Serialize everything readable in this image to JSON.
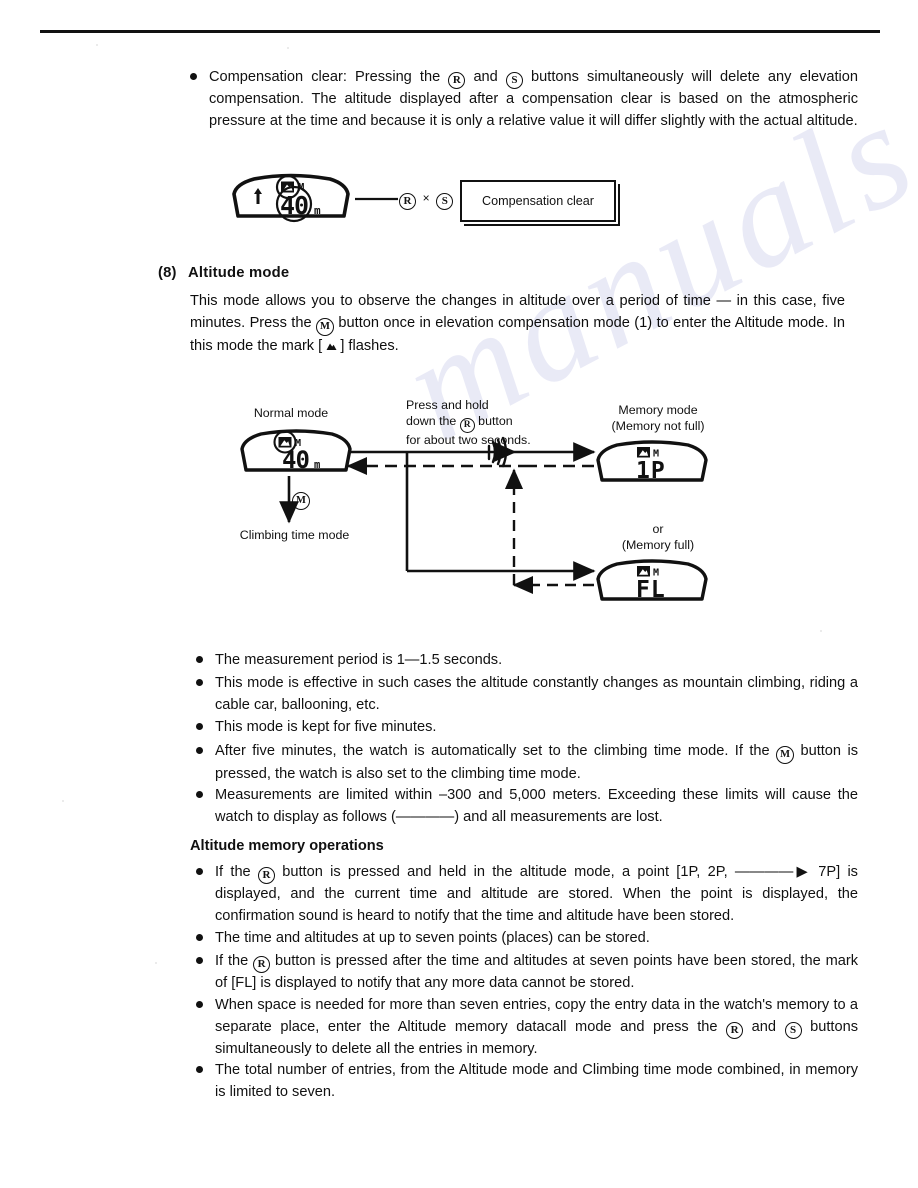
{
  "page": {
    "rule_present": true
  },
  "compensation_clear": {
    "bullet": "Compensation clear: Pressing the ⓡ and ⓢ buttons simultaneously will delete any elevation compensation. The altitude displayed after a compensation clear is based on the atmospheric pressure at the time and because it is only a relative value it will differ slightly with the actual altitude.",
    "text_part1": "Compensation clear: Pressing the ",
    "text_mid1": " and ",
    "text_part2": " buttons simultaneously will delete any elevation compensation. The altitude displayed after a compensation clear is based on the atmospheric pressure at the time and because it is only a relative value it will differ slightly with the actual altitude.",
    "btn_r": "R",
    "btn_s": "S",
    "times_symbol": "×",
    "box_label": "Compensation clear",
    "watch_value": "40",
    "watch_unit": "m",
    "watch_mark_m": "M"
  },
  "section": {
    "number": "(8)",
    "title": "Altitude mode",
    "intro_part1": "This mode allows you to observe the changes in altitude over a period of time — in this case, five minutes. Press the ",
    "intro_btn_m": "M",
    "intro_part2": " button once in elevation compensation mode (1) to enter the Altitude mode. In this mode the mark [ ",
    "intro_part3": " ] flashes."
  },
  "diagram": {
    "normal_mode_label": "Normal mode",
    "normal_mode_value": "40",
    "normal_mode_unit": "m",
    "normal_mode_mark_m": "M",
    "climbing_time_label": "Climbing time mode",
    "m_button": "M",
    "press_hold_line1": "Press and hold",
    "press_hold_line2_a": "down the ",
    "press_hold_btn_r": "R",
    "press_hold_line2_b": " button",
    "press_hold_line3": "for about two seconds.",
    "memory_mode_line1": "Memory mode",
    "memory_mode_line2": "(Memory not full)",
    "memory_mode_value": "1P",
    "memory_mode_mark_m": "M",
    "or_label": "or",
    "memory_full_label": "(Memory full)",
    "memory_full_value": "FL",
    "memory_full_mark_m": "M"
  },
  "notes": [
    {
      "id": "measurement-period",
      "text": "The measurement period is 1—1.5 seconds."
    },
    {
      "id": "effective-cases",
      "text": "This mode is effective in such cases the altitude constantly changes as mountain climbing, riding a cable car, ballooning, etc."
    },
    {
      "id": "kept-five-minutes",
      "text": "This mode is kept for five minutes."
    },
    {
      "id": "auto-climbing-time",
      "text_part1": "After five minutes, the watch is automatically set to the climbing time mode. If the ",
      "btn_m": "M",
      "text_part2": " button is pressed, the watch is also set to the climbing time mode."
    },
    {
      "id": "measurement-limits",
      "text": "Measurements are limited within –300 and 5,000 meters. Exceeding these limits will cause the watch to display as follows (————) and all measurements are lost."
    }
  ],
  "memory_ops": {
    "heading": "Altitude memory operations",
    "items": [
      {
        "id": "press-hold-r-point",
        "text_part1": "If the ",
        "btn_r": "R",
        "text_part2": " button is pressed and held in the altitude mode, a point [1P, 2P, ————▶ 7P] is displayed, and the current time and altitude are stored. When the point is displayed, the confirmation sound is heard to notify that the time and altitude have been stored."
      },
      {
        "id": "seven-points",
        "text": "The time and altitudes at up to seven points (places) can be stored."
      },
      {
        "id": "fl-mark",
        "text_part1": "If the ",
        "btn_r": "R",
        "text_part2": " button is pressed after the time and altitudes at seven points have been stored, the mark of [FL] is displayed to notify that any more data cannot be stored."
      },
      {
        "id": "copy-entries",
        "text_part1": "When space is needed for more than seven entries, copy the entry data in the watch's memory to a separate place, enter the Altitude memory datacall mode and press the ",
        "btn_r": "R",
        "text_mid": " and ",
        "btn_s": "S",
        "text_part2": " buttons simultaneously to delete all the entries in memory."
      },
      {
        "id": "total-entries",
        "text": "The total number of entries, from the Altitude mode and Climbing time mode combined, in memory is limited to seven."
      }
    ]
  },
  "watermark": {
    "text": "manualshive.com"
  }
}
